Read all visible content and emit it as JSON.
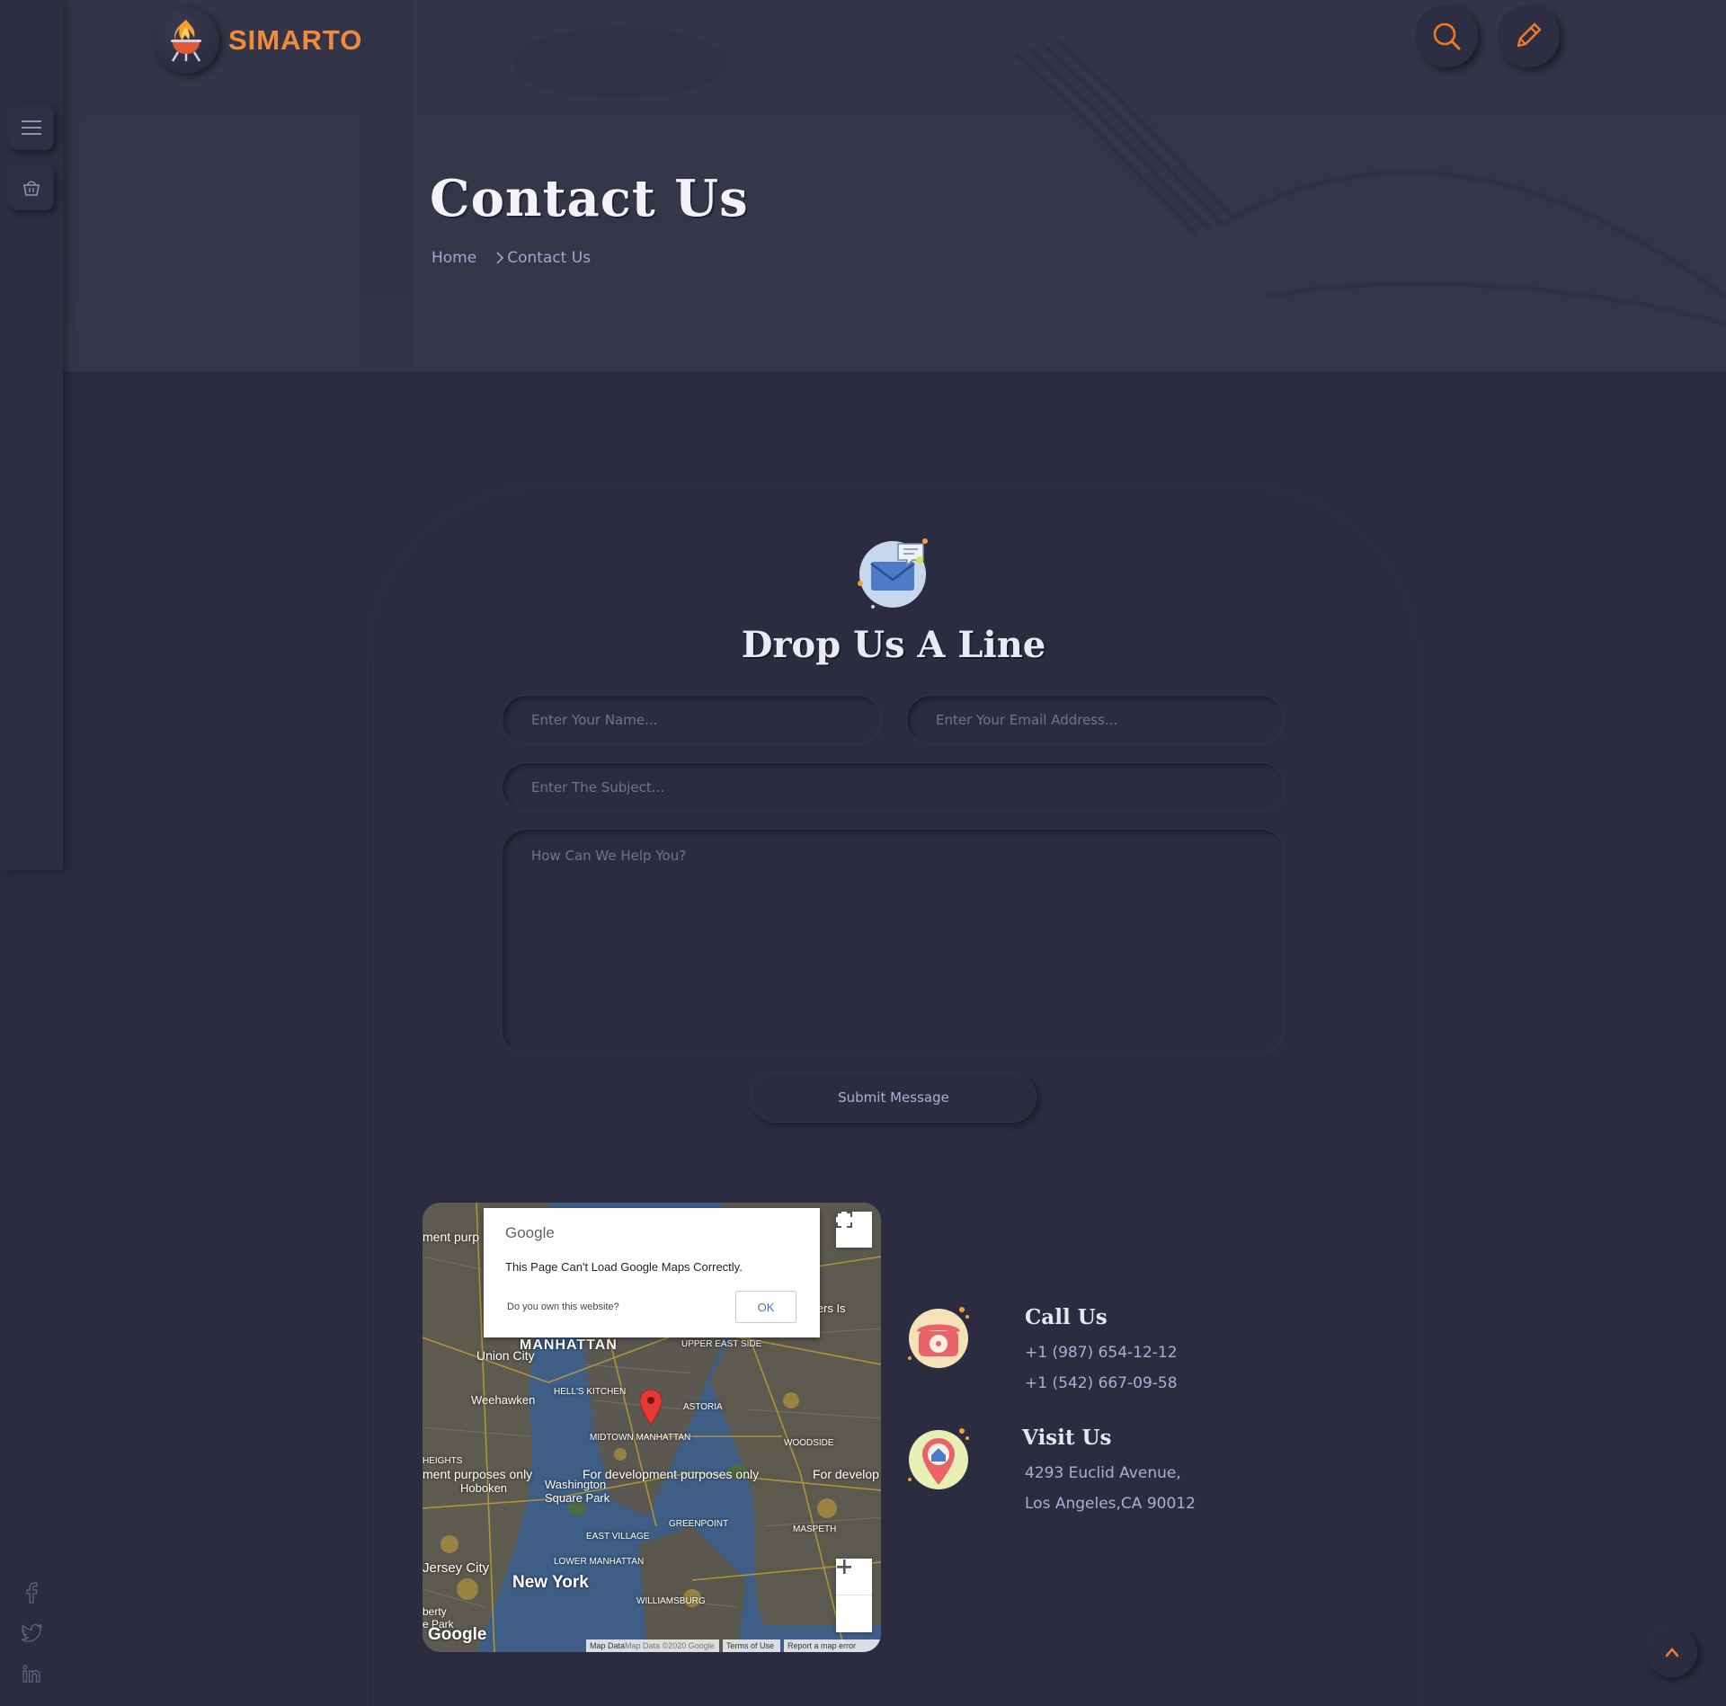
{
  "brand": {
    "name": "SIMARTO",
    "accent": "#ef8b3a"
  },
  "sidebar": {
    "icons": [
      "menu-icon",
      "cart-icon"
    ],
    "social": [
      "facebook-icon",
      "twitter-icon",
      "linkedin-icon"
    ]
  },
  "header": {
    "icons": [
      "search-icon",
      "pencil-icon"
    ]
  },
  "hero": {
    "title": "Contact Us",
    "breadcrumb": {
      "home": "Home",
      "current": "Contact Us"
    }
  },
  "form": {
    "title": "Drop Us A Line",
    "name_placeholder": "Enter Your Name...",
    "email_placeholder": "Enter Your Email Address...",
    "subject_placeholder": "Enter The Subject...",
    "message_placeholder": "How Can We Help You?",
    "submit_label": "Submit Message"
  },
  "map": {
    "dialog": {
      "brand": "Google",
      "message": "This Page Can't Load Google Maps Correctly.",
      "question": "Do you own this website?",
      "ok_label": "OK"
    },
    "labels": {
      "manhattan": "MANHATTAN",
      "union_city": "Union City",
      "weehawken": "Weehawken",
      "hells_kitchen": "HELL'S KITCHEN",
      "midtown": "MIDTOWN MANHATTAN",
      "astoria": "ASTORIA",
      "dev_purposes_1": "ment purposes only",
      "dev_purposes_2": "For development purposes only",
      "dev_purposes_3": "For develop",
      "dev_top": "ment purp",
      "hoboken": "Hoboken",
      "washington_square": "Washington Square Park",
      "east_village": "EAST VILLAGE",
      "jersey_city": "Jersey City",
      "new_york": "New York",
      "rikers": "Rikers Is",
      "upper_east_side": "UPPER EAST SIDE",
      "woodside": "WOODSIDE",
      "greenpoint": "GREENPOINT",
      "maspeth": "MASPETH",
      "williamsburg": "WILLIAMSBURG",
      "lower_manhattan": "LOWER MANHATTAN",
      "heights": "HEIGHTS",
      "liberty": "berty",
      "park": "e Park",
      "google_logo": "Google"
    },
    "footer": {
      "map_data": "Map Data",
      "copyright": "Map Data ©2020 Google",
      "terms": "Terms of Use",
      "report": "Report a map error"
    }
  },
  "contact": {
    "call": {
      "title": "Call Us",
      "phone1": "+1 (987) 654-12-12",
      "phone2": "+1 (542) 667-09-58"
    },
    "visit": {
      "title": "Visit Us",
      "line1": "4293 Euclid Avenue,",
      "line2": "Los Angeles,CA 90012"
    }
  }
}
